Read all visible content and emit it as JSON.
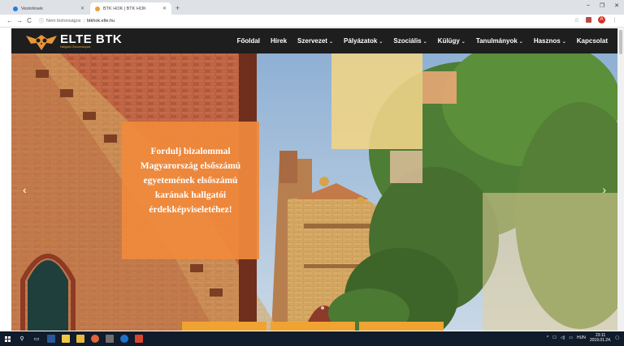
{
  "browser": {
    "tabs": [
      {
        "title": "Vezérlések",
        "active": false,
        "favicon_color": "#2a7ae4"
      },
      {
        "title": "BTK HÖK | BTK HÖK",
        "active": true,
        "favicon_color": "#e8a23a"
      }
    ],
    "new_tab": "+",
    "window_controls": {
      "minimize": "–",
      "maximize": "❐",
      "close": "✕"
    },
    "back": "←",
    "forward": "→",
    "reload": "C",
    "security_text": "Nem biztonságos",
    "url": "btkhok.elte.hu",
    "star": "☆",
    "menu_dots": "⋮",
    "profile_letter": "A"
  },
  "site": {
    "logo_title": "ELTE BTK",
    "logo_subtitle": "Hallgatói Önkormányzat",
    "menu": [
      {
        "label": "Főoldal",
        "dropdown": false
      },
      {
        "label": "Hírek",
        "dropdown": false
      },
      {
        "label": "Szervezet",
        "dropdown": true
      },
      {
        "label": "Pályázatok",
        "dropdown": true
      },
      {
        "label": "Szociális",
        "dropdown": true
      },
      {
        "label": "Külügy",
        "dropdown": true
      },
      {
        "label": "Tanulmányok",
        "dropdown": true
      },
      {
        "label": "Hasznos",
        "dropdown": true
      },
      {
        "label": "Kapcsolat",
        "dropdown": false
      }
    ],
    "hero_lines": [
      "Fordulj bizalommal",
      "Magyarország elsőszámú",
      "egyetemének elsőszámú",
      "karának hallgatói",
      "érdekképviseletéhez!"
    ],
    "arrow_left": "‹",
    "arrow_right": "›",
    "colors": {
      "header": "#1e1e1e",
      "accent": "#f08a3c",
      "tile": "#f0a331"
    }
  },
  "taskbar": {
    "tray_lang": "HUN",
    "time": "23:11",
    "date": "2019.01.24."
  }
}
